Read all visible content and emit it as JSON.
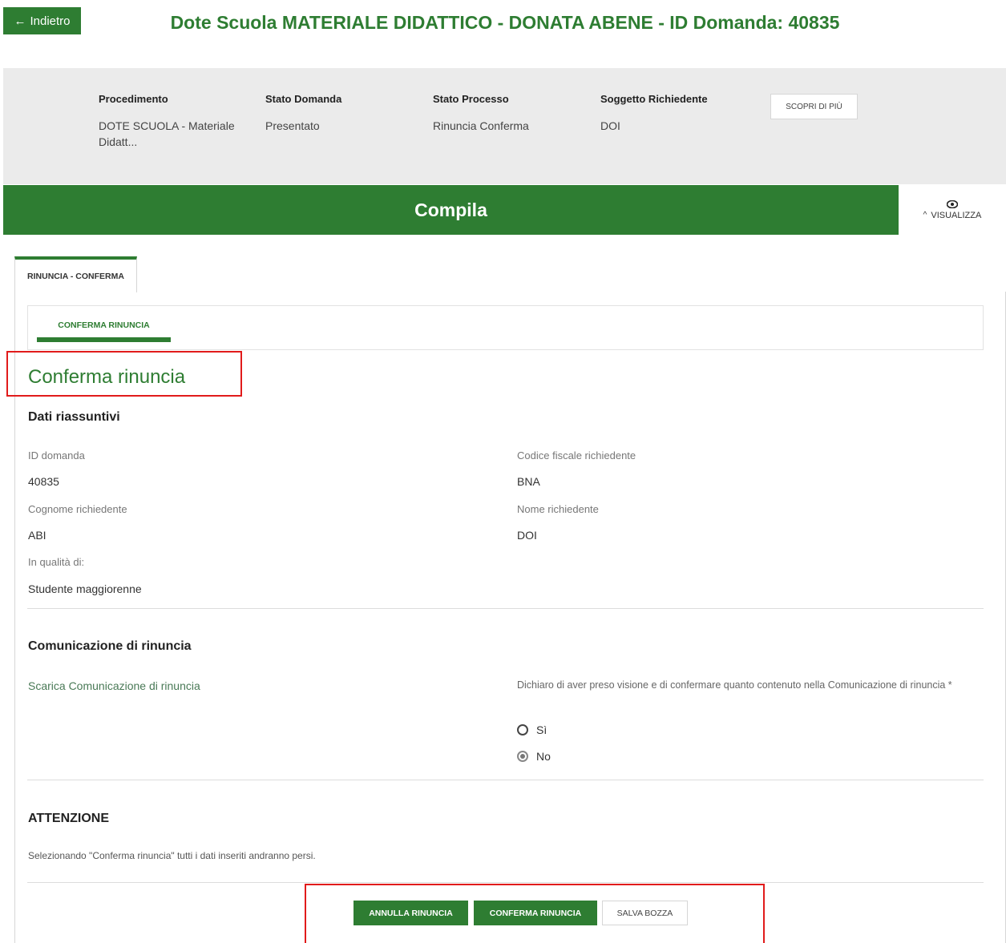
{
  "header": {
    "back_label": "Indietro",
    "back_icon": "arrow-left-icon",
    "title": "Dote Scuola MATERIALE DIDATTICO - DONATA ABENE - ID Domanda: 40835"
  },
  "info": {
    "procedimento_label": "Procedimento",
    "procedimento_value": "DOTE SCUOLA - Materiale Didatt...",
    "stato_domanda_label": "Stato Domanda",
    "stato_domanda_value": "Presentato",
    "stato_processo_label": "Stato Processo",
    "stato_processo_value": "Rinuncia Conferma",
    "soggetto_label": "Soggetto Richiedente",
    "soggetto_value": "DOI",
    "scopri_label": "SCOPRI DI PIÙ"
  },
  "compila": {
    "title": "Compila",
    "visualizza_label": "VISUALIZZA"
  },
  "tabs": {
    "main_tab": "RINUNCIA - CONFERMA",
    "sub_tab": "CONFERMA RINUNCIA"
  },
  "section": {
    "title": "Conferma rinuncia",
    "summary_heading": "Dati riassuntivi",
    "id_domanda_label": "ID domanda",
    "id_domanda_value": "40835",
    "cf_label": "Codice fiscale richiedente",
    "cf_value": "BNA",
    "cognome_label": "Cognome richiedente",
    "cognome_value": "ABI",
    "nome_label": "Nome richiedente",
    "nome_value": "DOI",
    "qualita_label": "In qualità di:",
    "qualita_value": "Studente maggiorenne"
  },
  "comunicazione": {
    "heading": "Comunicazione di rinuncia",
    "download_link": "Scarica Comunicazione di rinuncia",
    "declaration": "Dichiaro di aver preso visione e di confermare quanto contenuto nella Comunicazione di rinuncia *",
    "option_yes": "Sì",
    "option_no": "No",
    "selected": "No"
  },
  "attenzione": {
    "heading": "ATTENZIONE",
    "note": "Selezionando \"Conferma rinuncia\" tutti i dati inseriti andranno persi."
  },
  "actions": {
    "annulla_label": "ANNULLA RINUNCIA",
    "conferma_label": "CONFERMA RINUNCIA",
    "salva_label": "SALVA BOZZA"
  },
  "colors": {
    "primary_green": "#2e7d32",
    "highlight_red": "#e11b1b",
    "band_grey": "#ebebeb"
  }
}
